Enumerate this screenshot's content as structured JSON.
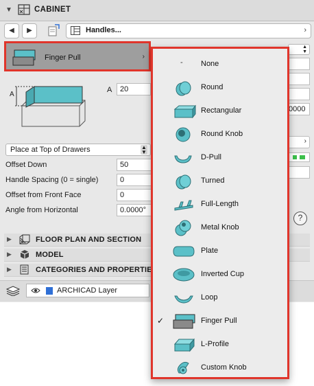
{
  "header": {
    "title": "CABINET",
    "collapse_icon": "chevron-down-icon",
    "cabinet_icon": "cabinet-settings-icon"
  },
  "nav": {
    "back_icon": "arrow-left-icon",
    "forward_icon": "arrow-right-icon",
    "favorites_icon": "favorites-icon",
    "page_selector_label": "Handles...",
    "page_selector_icon": "handles-panel-icon",
    "page_selector_arrow": "›"
  },
  "handle": {
    "selected_label": "Finger Pull",
    "arrow": "›",
    "dim_label": "A",
    "dim_value": "20",
    "preview_dim_label": "A"
  },
  "placement": {
    "selected": "Place at Top of Drawers",
    "right_selected": "Place at Top of D",
    "fields": [
      {
        "label": "Offset Down",
        "value": "50"
      },
      {
        "label": "Handle Spacing (0 = single)",
        "value": "0"
      },
      {
        "label": "Offset from Front Face",
        "value": "0"
      },
      {
        "label": "Angle from Horizontal",
        "value": "0.0000°"
      }
    ],
    "right_partial_value": "0000"
  },
  "sections": [
    {
      "label": "FLOOR PLAN AND SECTION",
      "icon": "floor-plan-icon"
    },
    {
      "label": "MODEL",
      "icon": "model-cube-icon"
    },
    {
      "label": "CATEGORIES AND PROPERTIES",
      "icon": "categories-icon"
    }
  ],
  "bottom": {
    "layer_label": "ARCHICAD Layer",
    "layer_icon": "layers-icon",
    "visibility_icon": "eye-icon",
    "help_icon": "help-icon",
    "help_glyph": "?"
  },
  "menu": {
    "checked_label": "Finger Pull",
    "check_glyph": "✓",
    "none_dash": "-",
    "items": [
      {
        "label": "None",
        "icon": "none-dash"
      },
      {
        "label": "Round",
        "icon": "round-handle-icon"
      },
      {
        "label": "Rectangular",
        "icon": "rectangular-handle-icon"
      },
      {
        "label": "Round Knob",
        "icon": "round-knob-icon"
      },
      {
        "label": "D-Pull",
        "icon": "d-pull-icon"
      },
      {
        "label": "Turned",
        "icon": "turned-handle-icon"
      },
      {
        "label": "Full-Length",
        "icon": "full-length-handle-icon"
      },
      {
        "label": "Metal Knob",
        "icon": "metal-knob-icon"
      },
      {
        "label": "Plate",
        "icon": "plate-handle-icon"
      },
      {
        "label": "Inverted Cup",
        "icon": "inverted-cup-icon"
      },
      {
        "label": "Loop",
        "icon": "loop-handle-icon"
      },
      {
        "label": "Finger Pull",
        "icon": "finger-pull-icon"
      },
      {
        "label": "L-Profile",
        "icon": "l-profile-icon"
      },
      {
        "label": "Custom Knob",
        "icon": "custom-knob-icon"
      }
    ]
  },
  "colors": {
    "handle_teal": "#5bc0c8",
    "highlight_red": "#e0352b",
    "layer_blue": "#2f6fd6",
    "status_green": "#3bbf4a"
  }
}
